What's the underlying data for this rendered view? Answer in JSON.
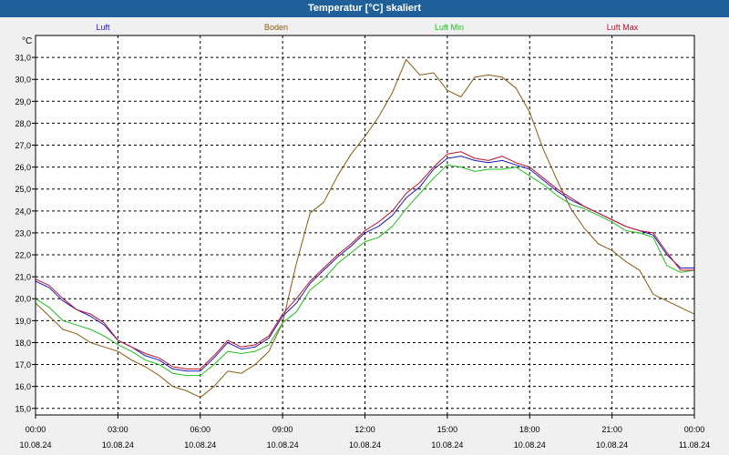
{
  "window": {
    "title": "Temperatur [°C] skaliert"
  },
  "colors": {
    "luft": "#1b1bbd",
    "boden": "#8b5a14",
    "luft_min": "#22c022",
    "luft_max": "#c0102a",
    "titlebar": "#1f5f9a"
  },
  "chart_data": {
    "type": "line",
    "ylabel": "°C",
    "ylim": [
      14.7,
      32.0
    ],
    "yticks": [
      15.0,
      16.0,
      17.0,
      18.0,
      19.0,
      20.0,
      21.0,
      22.0,
      23.0,
      24.0,
      25.0,
      26.0,
      27.0,
      28.0,
      29.0,
      30.0,
      31.0
    ],
    "ytick_labels": [
      "15,0",
      "16,0",
      "17,0",
      "18,0",
      "19,0",
      "20,0",
      "21,0",
      "22,0",
      "23,0",
      "24,0",
      "25,0",
      "26,0",
      "27,0",
      "28,0",
      "29,0",
      "30,0",
      "31,0"
    ],
    "xlim": [
      0,
      24
    ],
    "xticks": [
      {
        "time": "00:00",
        "date": "10.08.24"
      },
      {
        "time": "03:00",
        "date": "10.08.24"
      },
      {
        "time": "06:00",
        "date": "10.08.24"
      },
      {
        "time": "09:00",
        "date": "10.08.24"
      },
      {
        "time": "12:00",
        "date": "10.08.24"
      },
      {
        "time": "15:00",
        "date": "10.08.24"
      },
      {
        "time": "18:00",
        "date": "10.08.24"
      },
      {
        "time": "21:00",
        "date": "10.08.24"
      },
      {
        "time": "00:00",
        "date": "11.08.24"
      }
    ],
    "series": [
      {
        "name": "Luft",
        "key": "luft",
        "x": [
          0,
          0.5,
          1,
          1.5,
          2,
          2.5,
          3,
          3.5,
          4,
          4.5,
          5,
          5.5,
          6,
          6.5,
          7,
          7.5,
          8,
          8.5,
          9,
          9.5,
          10,
          10.5,
          11,
          11.5,
          12,
          12.5,
          13,
          13.5,
          14,
          14.5,
          15,
          15.5,
          16,
          16.5,
          17,
          17.5,
          18,
          18.5,
          19,
          19.5,
          20,
          20.5,
          21,
          21.5,
          22,
          22.5,
          23,
          23.5,
          24
        ],
        "y": [
          20.8,
          20.5,
          19.9,
          19.5,
          19.2,
          18.8,
          18.1,
          17.8,
          17.4,
          17.2,
          16.8,
          16.7,
          16.7,
          17.3,
          18.0,
          17.7,
          17.8,
          18.2,
          19.2,
          19.8,
          20.7,
          21.3,
          21.9,
          22.4,
          23.0,
          23.3,
          23.8,
          24.6,
          25.1,
          25.9,
          26.4,
          26.5,
          26.3,
          26.2,
          26.3,
          26.1,
          25.9,
          25.4,
          24.9,
          24.5,
          24.2,
          23.9,
          23.6,
          23.3,
          23.1,
          22.9,
          22.0,
          21.4,
          21.4
        ]
      },
      {
        "name": "Boden",
        "key": "boden",
        "x": [
          0,
          0.5,
          1,
          1.5,
          2,
          2.5,
          3,
          3.5,
          4,
          4.5,
          5,
          5.5,
          6,
          6.5,
          7,
          7.5,
          8,
          8.5,
          9,
          9.5,
          10,
          10.5,
          11,
          11.5,
          12,
          12.5,
          13,
          13.5,
          14,
          14.5,
          15,
          15.5,
          16,
          16.5,
          17,
          17.5,
          18,
          18.5,
          19,
          19.5,
          20,
          20.5,
          21,
          21.5,
          22,
          22.5,
          23,
          23.5,
          24
        ],
        "y": [
          19.8,
          19.2,
          18.6,
          18.4,
          18.0,
          17.8,
          17.6,
          17.2,
          16.9,
          16.5,
          16.0,
          15.8,
          15.5,
          16.0,
          16.7,
          16.6,
          17.0,
          17.6,
          18.9,
          21.6,
          23.9,
          24.4,
          25.6,
          26.6,
          27.4,
          28.3,
          29.4,
          30.9,
          30.2,
          30.3,
          29.5,
          29.2,
          30.1,
          30.2,
          30.1,
          29.6,
          28.5,
          26.8,
          25.4,
          24.1,
          23.2,
          22.5,
          22.2,
          21.7,
          21.3,
          20.2,
          19.9,
          19.6,
          19.3
        ]
      },
      {
        "name": "Luft Min",
        "key": "luft_min",
        "x": [
          0,
          0.5,
          1,
          1.5,
          2,
          2.5,
          3,
          3.5,
          4,
          4.5,
          5,
          5.5,
          6,
          6.5,
          7,
          7.5,
          8,
          8.5,
          9,
          9.5,
          10,
          10.5,
          11,
          11.5,
          12,
          12.5,
          13,
          13.5,
          14,
          14.5,
          15,
          15.5,
          16,
          16.5,
          17,
          17.5,
          18,
          18.5,
          19,
          19.5,
          20,
          20.5,
          21,
          21.5,
          22,
          22.5,
          23,
          23.5,
          24
        ],
        "y": [
          20.0,
          19.6,
          19.0,
          18.8,
          18.6,
          18.3,
          17.9,
          17.6,
          17.2,
          17.0,
          16.6,
          16.5,
          16.5,
          17.0,
          17.6,
          17.5,
          17.6,
          17.9,
          18.9,
          19.4,
          20.4,
          20.9,
          21.6,
          22.1,
          22.6,
          22.8,
          23.3,
          24.1,
          24.8,
          25.5,
          26.1,
          26.0,
          25.8,
          25.9,
          25.9,
          26.0,
          25.6,
          25.2,
          24.7,
          24.3,
          24.1,
          23.8,
          23.5,
          23.1,
          23.0,
          22.8,
          21.5,
          21.2,
          21.3
        ]
      },
      {
        "name": "Luft Max",
        "key": "luft_max",
        "x": [
          0,
          0.5,
          1,
          1.5,
          2,
          2.5,
          3,
          3.5,
          4,
          4.5,
          5,
          5.5,
          6,
          6.5,
          7,
          7.5,
          8,
          8.5,
          9,
          9.5,
          10,
          10.5,
          11,
          11.5,
          12,
          12.5,
          13,
          13.5,
          14,
          14.5,
          15,
          15.5,
          16,
          16.5,
          17,
          17.5,
          18,
          18.5,
          19,
          19.5,
          20,
          20.5,
          21,
          21.5,
          22,
          22.5,
          23,
          23.5,
          24
        ],
        "y": [
          20.9,
          20.6,
          20.0,
          19.5,
          19.3,
          18.9,
          18.1,
          17.8,
          17.5,
          17.3,
          16.9,
          16.8,
          16.8,
          17.4,
          18.1,
          17.8,
          17.9,
          18.3,
          19.3,
          20.0,
          20.8,
          21.4,
          22.0,
          22.5,
          23.1,
          23.5,
          24.0,
          24.8,
          25.3,
          26.0,
          26.6,
          26.7,
          26.4,
          26.3,
          26.5,
          26.2,
          26.0,
          25.5,
          25.0,
          24.6,
          24.2,
          23.9,
          23.6,
          23.3,
          23.1,
          23.0,
          22.1,
          21.3,
          21.3
        ]
      }
    ]
  }
}
